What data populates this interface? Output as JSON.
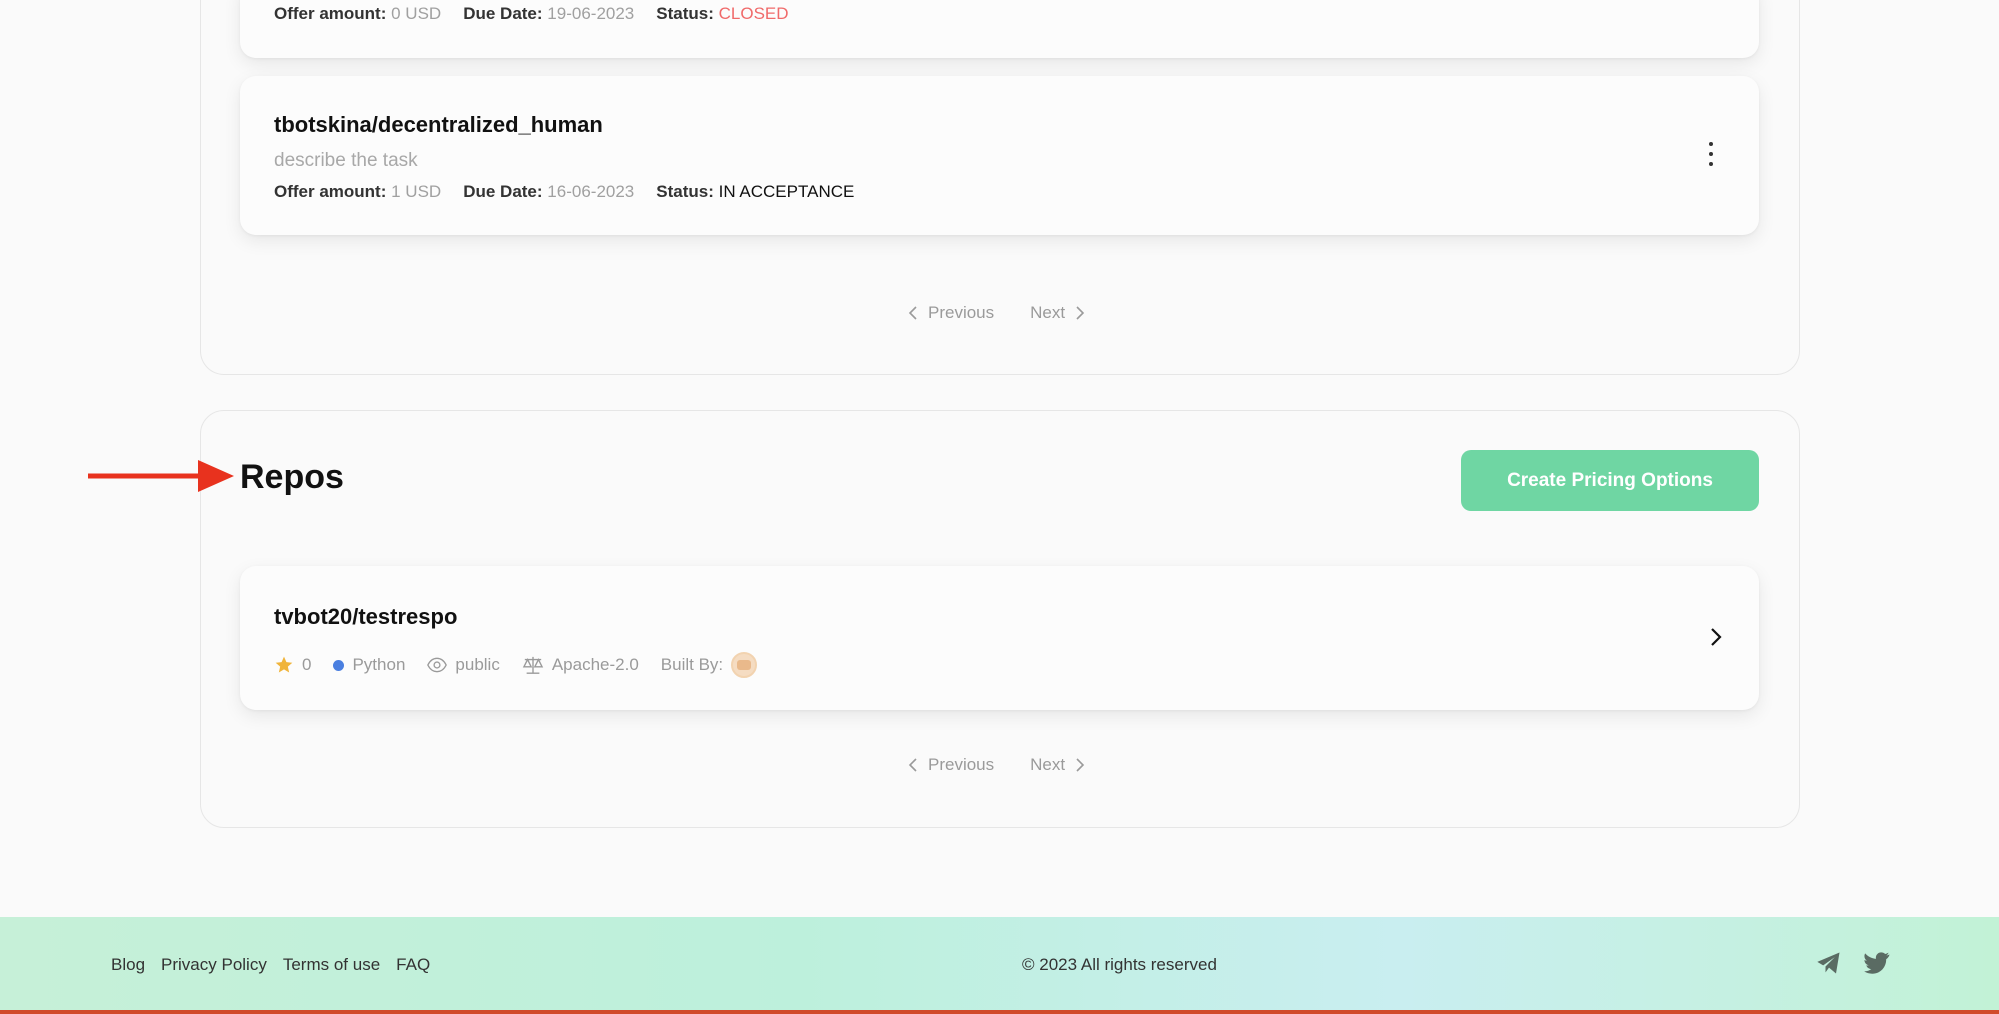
{
  "tasks": [
    {
      "offer_label": "Offer amount:",
      "offer_value": "0 USD",
      "due_label": "Due Date:",
      "due_value": "19-06-2023",
      "status_label": "Status:",
      "status_value": "CLOSED"
    },
    {
      "title": "tbotskina/decentralized_human",
      "description": "describe the task",
      "offer_label": "Offer amount:",
      "offer_value": "1 USD",
      "due_label": "Due Date:",
      "due_value": "16-06-2023",
      "status_label": "Status:",
      "status_value": "IN ACCEPTANCE"
    }
  ],
  "pagination": {
    "previous": "Previous",
    "next": "Next"
  },
  "repos": {
    "title": "Repos",
    "create_button": "Create Pricing Options",
    "items": [
      {
        "name": "tvbot20/testrespo",
        "stars": "0",
        "language": "Python",
        "visibility": "public",
        "license": "Apache-2.0",
        "built_by_label": "Built By:"
      }
    ]
  },
  "footer": {
    "links": [
      "Blog",
      "Privacy Policy",
      "Terms of use",
      "FAQ"
    ],
    "copyright": "© 2023 All rights reserved"
  },
  "colors": {
    "accent": "#6fd6a3",
    "closed": "#f06a6a",
    "language_dot": "#4a7fe0",
    "annotation_arrow": "#e8321e"
  },
  "icons": [
    "kebab-menu-icon",
    "chevron-left-icon",
    "chevron-right-icon",
    "star-icon",
    "eye-icon",
    "scale-icon",
    "telegram-icon",
    "twitter-icon",
    "arrow-annotation-icon"
  ]
}
